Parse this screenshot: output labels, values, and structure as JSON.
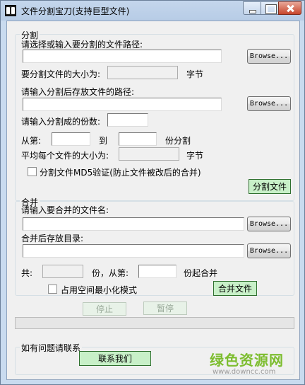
{
  "window": {
    "title": "文件分割宝刀(支持巨型文件)",
    "app_icon": "scissors-blade-icon",
    "controls": [
      "minimize-icon",
      "maximize-icon",
      "close-icon"
    ]
  },
  "split": {
    "legend": "分割",
    "path_label": "请选择或输入要分割的文件路径:",
    "path_value": "",
    "browse_label": "Browse...",
    "size_label": "要分割文件的大小为:",
    "size_value": "",
    "size_unit": "字节",
    "dest_label": "请输入分割后存放文件的路径:",
    "dest_value": "",
    "browse2_label": "Browse...",
    "parts_label": "请输入分割成的份数:",
    "parts_value": "",
    "from_label": "从第:",
    "from_value": "",
    "to_label": "到",
    "to_value": "",
    "to_suffix": "份分割",
    "avg_label": "平均每个文件的大小为:",
    "avg_value": "",
    "avg_unit": "字节",
    "md5_label": "分割文件MD5验证(防止文件被改后的合并)",
    "md5_checked": false,
    "split_button": "分割文件"
  },
  "merge": {
    "legend": "合并",
    "name_label": "请输入要合并的文件名:",
    "name_value": "",
    "browse_label": "Browse...",
    "dir_label": "合并后存放目录:",
    "dir_value": "",
    "browse2_label": "Browse...",
    "total_label": "共:",
    "total_value": "",
    "from_label": "份，从第:",
    "from_value": "",
    "from_suffix": "份起合并",
    "minspace_label": "占用空间最小化模式",
    "minspace_checked": false,
    "merge_button": "合并文件"
  },
  "controls": {
    "stop_label": "停止",
    "pause_label": "暂停",
    "progress": 0
  },
  "contact": {
    "legend": "如有问题请联系",
    "button_label": "联系我们"
  },
  "watermark": {
    "cn": "绿色资源网",
    "url": "www.downcc.com"
  },
  "colors": {
    "title_bar": "#b7cce6",
    "close_button": "#c7462c",
    "green_button": "#c8f0c8",
    "progress_fill": "#06b025",
    "watermark_green": "#7dbd2f"
  }
}
